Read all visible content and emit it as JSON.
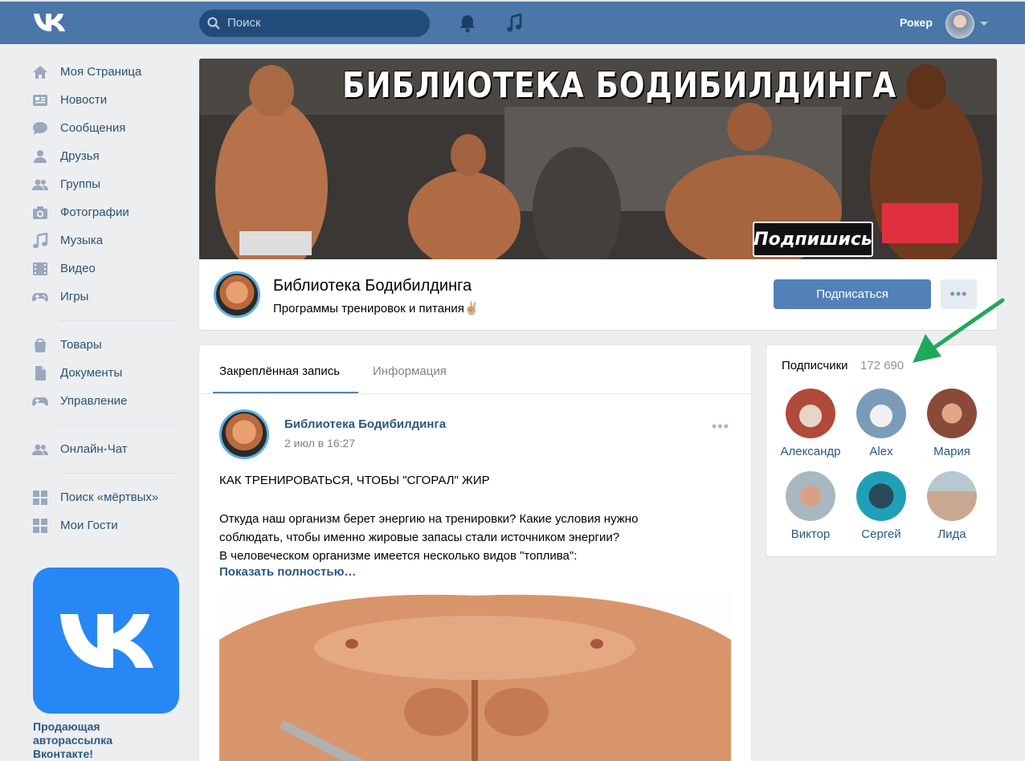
{
  "header": {
    "search_placeholder": "Поиск",
    "user_name": "Рокер"
  },
  "sidebar": {
    "items": [
      {
        "label": "Моя Страница",
        "icon": "home-icon"
      },
      {
        "label": "Новости",
        "icon": "news-icon"
      },
      {
        "label": "Сообщения",
        "icon": "messages-icon"
      },
      {
        "label": "Друзья",
        "icon": "friends-icon"
      },
      {
        "label": "Группы",
        "icon": "groups-icon"
      },
      {
        "label": "Фотографии",
        "icon": "camera-icon"
      },
      {
        "label": "Музыка",
        "icon": "music-icon"
      },
      {
        "label": "Видео",
        "icon": "video-icon"
      },
      {
        "label": "Игры",
        "icon": "gamepad-icon"
      },
      {
        "label": "Товары",
        "icon": "bag-icon"
      },
      {
        "label": "Документы",
        "icon": "document-icon"
      },
      {
        "label": "Управление",
        "icon": "gamepad-icon"
      },
      {
        "label": "Онлайн-Чат",
        "icon": "groups-icon"
      },
      {
        "label": "Поиск «мёртвых»",
        "icon": "apps-icon"
      },
      {
        "label": "Мои Гости",
        "icon": "apps-icon"
      }
    ],
    "ad_text": "Продающая авторассылка Вконтакте!"
  },
  "group": {
    "cover_title": "БИБЛИОТЕКА БОДИБИЛДИНГА",
    "cover_button": "Подпишись",
    "name": "Библиотека Бодибилдинга",
    "status": "Программы тренировок и питания✌🏼",
    "subscribe_label": "Подписаться",
    "more_label": "•••"
  },
  "post": {
    "tabs": [
      "Закреплённая запись",
      "Информация"
    ],
    "author": "Библиотека Бодибилдинга",
    "date": "2 июл в 16:27",
    "menu": "•••",
    "title_line": "КАК ТРЕНИРОВАТЬСЯ, ЧТОБЫ \"СГОРАЛ\" ЖИР",
    "body_lines": [
      "Откуда наш организм берет энергию на тренировки? Какие условия нужно",
      "соблюдать, чтобы именно жировые запасы стали источником энергии?",
      "В человеческом организме имеется несколько видов \"топлива\":"
    ],
    "show_more": "Показать полностью…"
  },
  "subscribers": {
    "title": "Подписчики",
    "count": "172 690",
    "people": [
      {
        "name": "Александр",
        "color": "#b04a3a"
      },
      {
        "name": "Alex",
        "color": "#7a9cb8"
      },
      {
        "name": "Мария",
        "color": "#8a4a3a"
      },
      {
        "name": "Виктор",
        "color": "#a8b8c0"
      },
      {
        "name": "Сергей",
        "color": "#1fa0b8"
      },
      {
        "name": "Лида",
        "color": "#c8a890"
      }
    ]
  },
  "colors": {
    "header": "#4a76a8",
    "accent": "#5181b8",
    "link": "#2a5885",
    "arrow": "#1ea95a"
  }
}
